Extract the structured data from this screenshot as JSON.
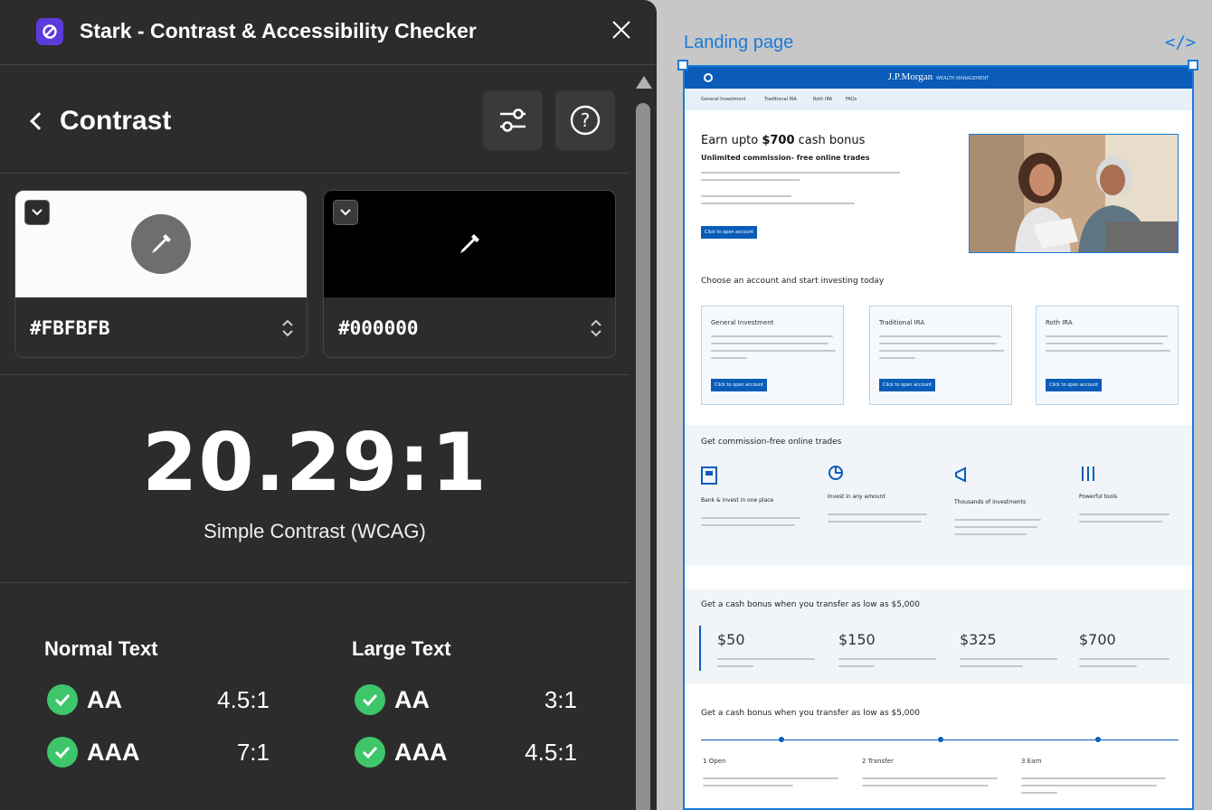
{
  "app": {
    "title": "Stark - Contrast & Accessibility Checker",
    "logo_icon": "stark-logo-icon",
    "accent_color": "#5b3bdb"
  },
  "screen": {
    "title": "Contrast",
    "back_icon": "chevron-left-icon",
    "settings_icon": "sliders-icon",
    "help_icon": "question-circle-icon"
  },
  "colors": {
    "foreground": {
      "hex": "#FBFBFB",
      "swatch": "#fbfbfb"
    },
    "background": {
      "hex": "#000000",
      "swatch": "#000000"
    }
  },
  "result": {
    "ratio": "20.29:1",
    "label": "Simple Contrast (WCAG)",
    "pass_color": "#3ec66a"
  },
  "normal_text": {
    "title": "Normal Text",
    "aa": {
      "level": "AA",
      "threshold": "4.5:1"
    },
    "aaa": {
      "level": "AAA",
      "threshold": "7:1"
    }
  },
  "large_text": {
    "title": "Large Text",
    "aa": {
      "level": "AA",
      "threshold": "3:1"
    },
    "aaa": {
      "level": "AAA",
      "threshold": "4.5:1"
    }
  },
  "canvas": {
    "frame_name": "Landing page",
    "code_label": "</>",
    "selection_color": "#1a7ad9"
  },
  "landing": {
    "brand": "J.P.Morgan",
    "brand_sub": "WEALTH MANAGEMENT",
    "nav": [
      "General Investment",
      "Traditional IRA",
      "Roth IRA",
      "FAQs"
    ],
    "hero_title_prefix": "Earn upto ",
    "hero_title_amount": "$700",
    "hero_title_suffix": " cash bonus",
    "hero_subtitle": "Unlimited commission- free online trades",
    "cta": "Click to open account",
    "accounts_title": "Choose an account and start investing today",
    "accounts": [
      "General Investment",
      "Traditional IRA",
      "Roth IRA"
    ],
    "trades_title": "Get commission-free online trades",
    "features": [
      "Bank & invest in one place",
      "Invest in any amount",
      "Thousands of investments",
      "Powerful tools"
    ],
    "bonus_title": "Get a cash bonus when you transfer as low as $5,000",
    "amounts": [
      "$50",
      "$150",
      "$325",
      "$700"
    ],
    "bonus_title_2": "Get a cash bonus when you transfer as low as $5,000",
    "steps": [
      "1 Open",
      "2 Transfer",
      "3 Earn"
    ]
  }
}
